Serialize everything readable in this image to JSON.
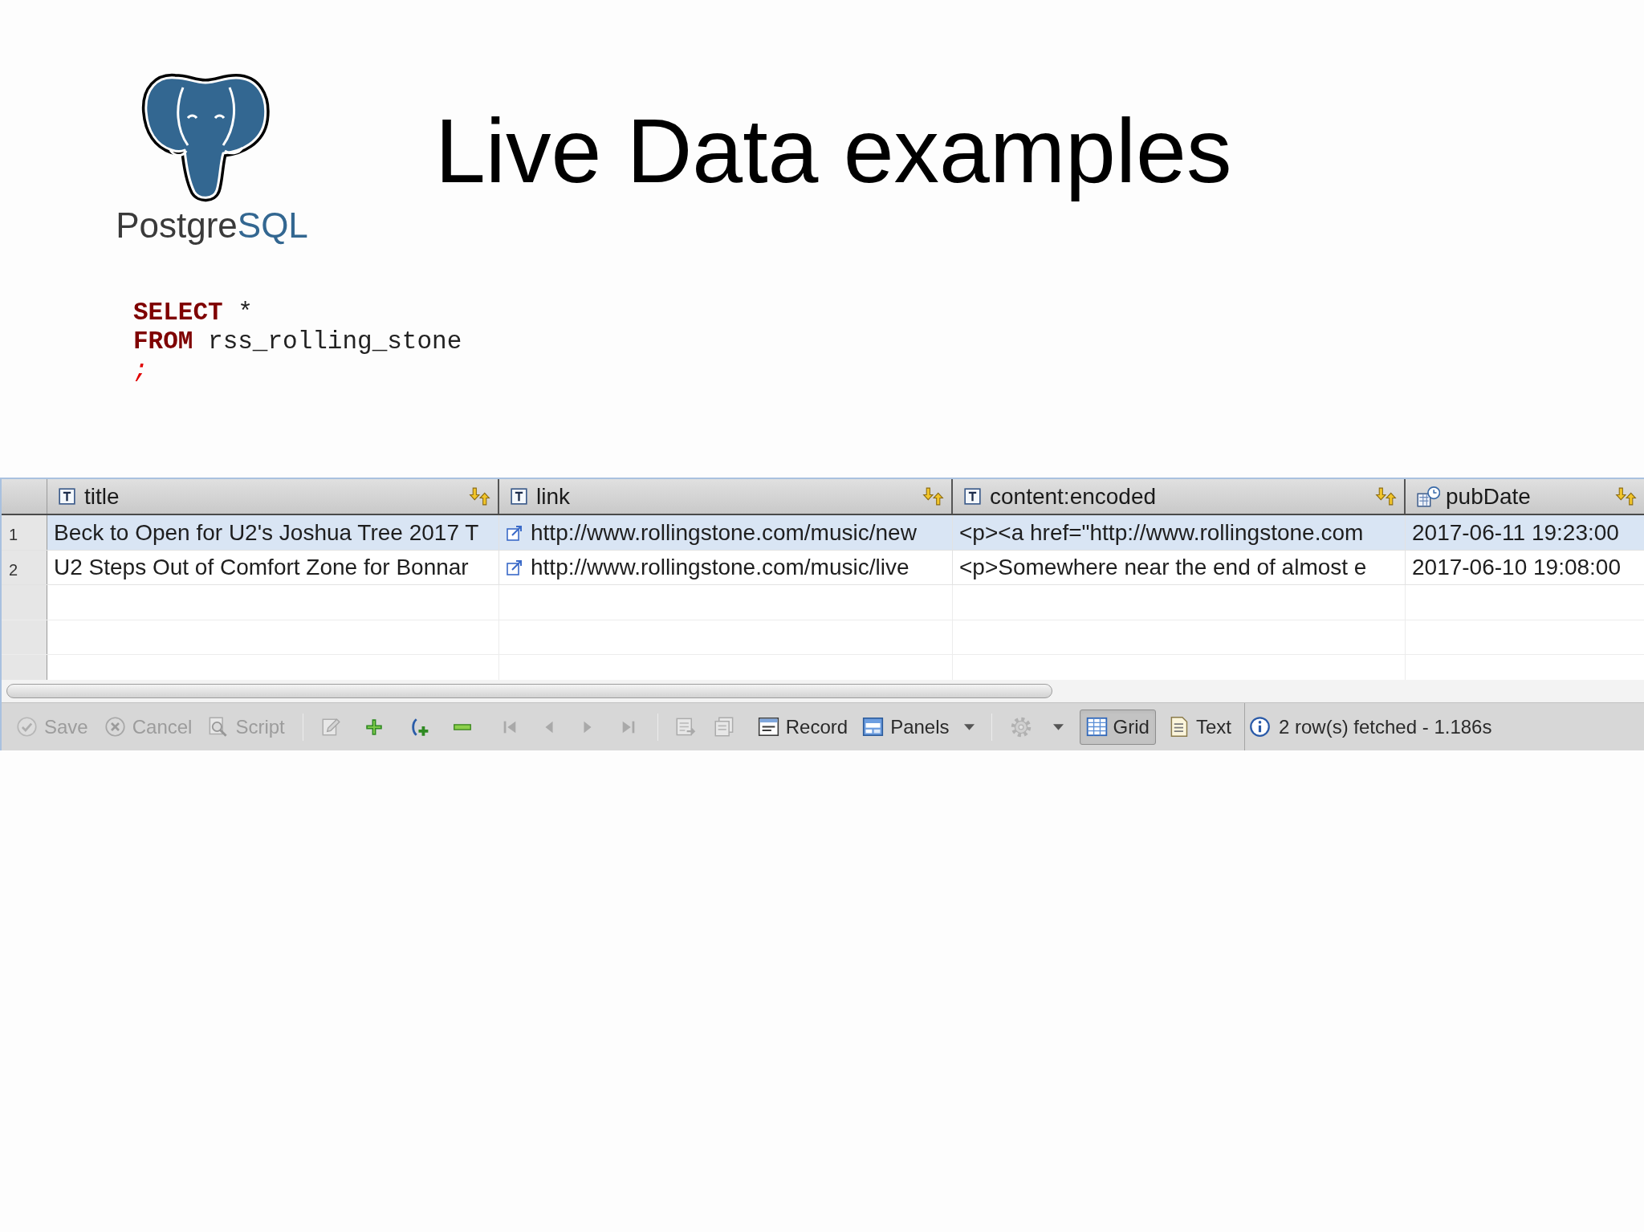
{
  "logo": {
    "wordmark": [
      "Postgre",
      "SQL"
    ]
  },
  "title": "Live Data examples",
  "sql": {
    "lines": [
      {
        "tokens": [
          {
            "kind": "keyword",
            "text": "SELECT"
          },
          {
            "kind": "plain",
            "text": "*"
          }
        ]
      },
      {
        "tokens": [
          {
            "kind": "keyword",
            "text": "FROM"
          },
          {
            "kind": "plain",
            "text": "rss_rolling_stone"
          }
        ]
      },
      {
        "tokens": [
          {
            "kind": "punctuation",
            "text": ";"
          }
        ]
      }
    ]
  },
  "result_grid": {
    "columns": [
      {
        "label": "title",
        "kind": "text"
      },
      {
        "label": "link",
        "kind": "link"
      },
      {
        "label": "content:encoded",
        "kind": "text"
      },
      {
        "label": "pubDate",
        "kind": "timestamp"
      }
    ],
    "rows": [
      {
        "number": "1",
        "selected": true,
        "cells": [
          "Beck to Open for U2's Joshua Tree 2017 T",
          "http://www.rollingstone.com/music/new",
          "<p><a href=\"http://www.rollingstone.com",
          "2017-06-11 19:23:00"
        ]
      },
      {
        "number": "2",
        "selected": false,
        "cells": [
          "U2 Steps Out of Comfort Zone for Bonnar",
          "http://www.rollingstone.com/music/live",
          "<p>Somewhere near the end of almost e",
          "2017-06-10 19:08:00"
        ]
      }
    ]
  },
  "toolbar": {
    "edit_buttons": [
      {
        "label": "Save",
        "disabled": true
      },
      {
        "label": "Cancel",
        "disabled": true
      },
      {
        "label": "Script",
        "disabled": true
      }
    ],
    "row_tools": [
      {
        "disabled": true
      },
      {
        "disabled": false
      },
      {
        "disabled": false
      },
      {
        "disabled": false
      }
    ],
    "navigation": [
      {
        "disabled": true
      },
      {
        "disabled": true
      },
      {
        "disabled": true
      },
      {
        "disabled": true
      }
    ],
    "more_tools": [
      {
        "disabled": true
      },
      {
        "disabled": true
      }
    ],
    "record_button": {
      "label": "Record"
    },
    "panels_button": {
      "label": "Panels"
    },
    "settings_button": {
      "disabled": true
    },
    "view_modes": [
      {
        "label": "Grid",
        "selected": true
      },
      {
        "label": "Text",
        "selected": false
      }
    ],
    "status": "2 row(s) fetched - 1.186s"
  }
}
